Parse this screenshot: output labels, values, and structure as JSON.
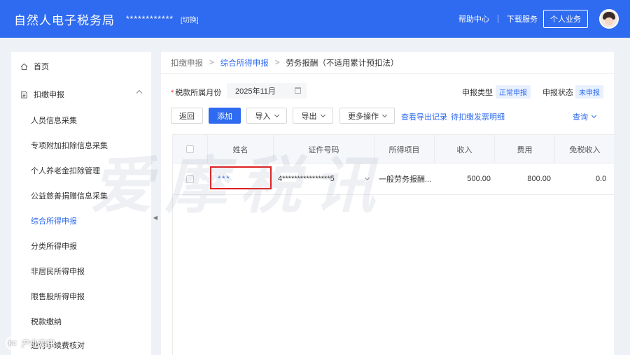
{
  "header": {
    "app_title": "自然人电子税务局",
    "masked_name": "************",
    "switch_label": "[切换]",
    "help_label": "帮助中心",
    "download_label": "下载服务",
    "personal_label": "个人业务"
  },
  "sidebar": {
    "home": "首页",
    "group": "扣缴申报",
    "items": [
      "人员信息采集",
      "专项附加扣除信息采集",
      "个人养老金扣除管理",
      "公益慈善捐赠信息采集",
      "综合所得申报",
      "分类所得申报",
      "非居民所得申报",
      "限售股所得申报",
      "税款缴纳",
      "退付手续费核对"
    ],
    "active_index": 4
  },
  "breadcrumb": {
    "root": "扣缴申报",
    "parent": "综合所得申报",
    "current": "劳务报酬（不适用累计预扣法）"
  },
  "filters": {
    "month_label": "税款所属月份",
    "month_value": "2025年11月",
    "type_label": "申报类型",
    "type_value": "正常申报",
    "status_label": "申报状态",
    "status_value": "未申报"
  },
  "toolbar": {
    "back": "返回",
    "add": "添加",
    "import": "导入",
    "export": "导出",
    "more": "更多操作",
    "export_records": "查看导出记录",
    "invoice_detail": "待扣缴发票明细",
    "query": "查询"
  },
  "table": {
    "columns": [
      "姓名",
      "证件号码",
      "所得项目",
      "收入",
      "费用",
      "免税收入"
    ],
    "rows": [
      {
        "name": "***",
        "id_number": "4****************5",
        "item": "一般劳务报酬...",
        "income": "500.00",
        "expense": "800.00",
        "tax_free": "0.0"
      }
    ]
  },
  "watermark": {
    "text": "爱摩税讯",
    "logo_text": "KC",
    "logo_caption": "产业资讯"
  }
}
